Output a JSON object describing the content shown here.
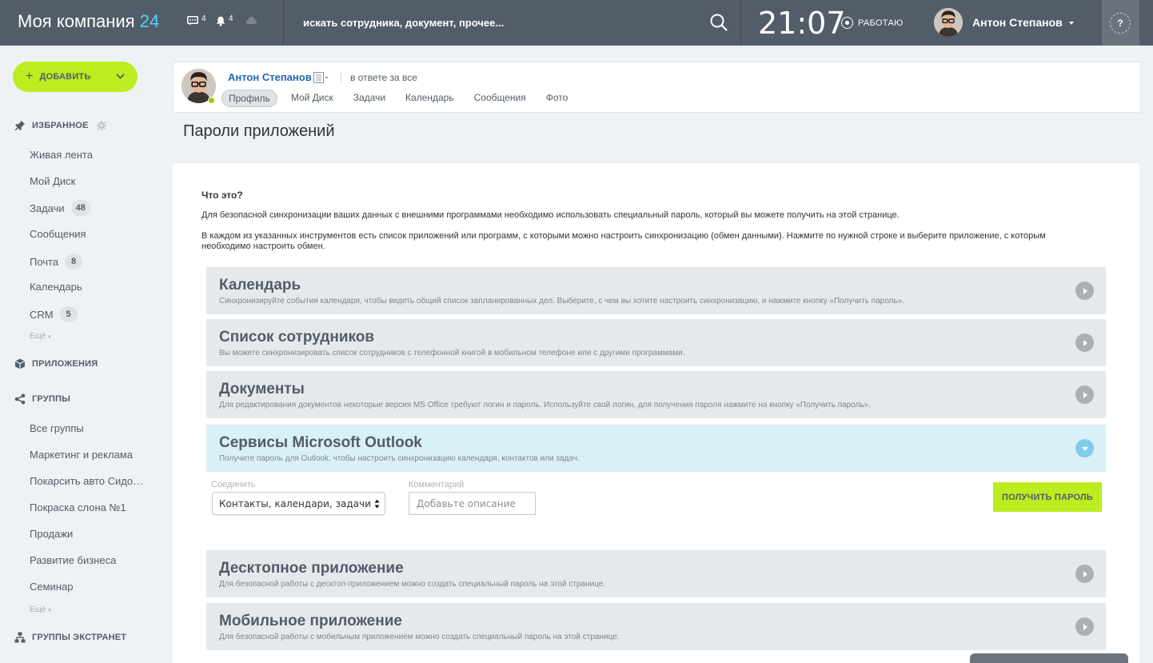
{
  "header": {
    "logo_text": "Моя компания",
    "logo_number": "24",
    "messages_count": "4",
    "notifications_count": "4",
    "search_placeholder": "искать сотрудника, документ, прочее...",
    "clock": "21:07",
    "work_status": "РАБОТАЮ",
    "user_name": "Антон Степанов",
    "help_label": "?"
  },
  "sidebar": {
    "add_label": "ДОБАВИТЬ",
    "favorites_title": "ИЗБРАННОЕ",
    "favorites": [
      {
        "label": "Живая лента",
        "badge": ""
      },
      {
        "label": "Мой Диск",
        "badge": ""
      },
      {
        "label": "Задачи",
        "badge": "48"
      },
      {
        "label": "Сообщения",
        "badge": ""
      },
      {
        "label": "Почта",
        "badge": "8"
      },
      {
        "label": "Календарь",
        "badge": ""
      },
      {
        "label": "CRM",
        "badge": "5"
      }
    ],
    "more_label": "Ещё",
    "apps_title": "ПРИЛОЖЕНИЯ",
    "groups_title": "ГРУППЫ",
    "groups": [
      "Все группы",
      "Маркетинг и реклама",
      "Покарсить авто Сидо…",
      "Покраска слона №1",
      "Продажи",
      "Развитие бизнеса",
      "Семинар"
    ],
    "extranet_title": "ГРУППЫ ЭКСТРАНЕТ"
  },
  "profile": {
    "name": "Антон Степанов",
    "status": "в ответе за все",
    "tabs": [
      "Профиль",
      "Мой Диск",
      "Задачи",
      "Календарь",
      "Сообщения",
      "Фото"
    ],
    "active_tab": "Профиль"
  },
  "page": {
    "title": "Пароли приложений",
    "what_title": "Что это?",
    "desc1": "Для безопасной синхронизации ваших данных с внешними программами необходимо использовать специальный пароль, который вы можете получить на этой странице.",
    "desc2": "В каждом из указанных инструментов есть список приложений или программ, с которыми можно настроить синхронизацию (обмен данными). Нажмите по нужной строке и выберите приложение, с которым необходимо настроить обмен."
  },
  "sections": [
    {
      "title": "Календарь",
      "subtitle": "Синхронизируйте события календаря, чтобы видеть общий список запланированных дел. Выберите, с чем вы хотите настроить синхронизацию, и нажмите кнопку «Получить пароль».",
      "open": false
    },
    {
      "title": "Список сотрудников",
      "subtitle": "Вы можете синхронизировать список сотрудников с телефонной книгой в мобильном телефоне или с другими программами.",
      "open": false
    },
    {
      "title": "Документы",
      "subtitle": "Для редактирования документов некоторые версия MS Office требуют логин и пароль. Используйте свой логин, для получения пароля нажмите на кнопку «Получить пароль».",
      "open": false
    },
    {
      "title": "Сервисы Microsoft Outlook",
      "subtitle": "Получите пароль для Outlook, чтобы настроить синхронизацию календаря, контактов или задач.",
      "open": true
    },
    {
      "title": "Десктопное приложение",
      "subtitle": "Для безопасной работы с десктоп-приложением можно создать специальный пароль на этой странице.",
      "open": false
    },
    {
      "title": "Мобильное приложение",
      "subtitle": "Для безопасной работы с мобильным приложением можно создать специальный пароль на этой странице.",
      "open": false
    }
  ],
  "outlook_form": {
    "connect_label": "Соединить",
    "connect_value": "Контакты, календари, задачи",
    "comment_label": "Комментарий",
    "comment_placeholder": "Добавьте описание",
    "get_password_label": "ПОЛУЧИТЬ ПАРОЛЬ"
  },
  "colors": {
    "header_bg": "#535c69",
    "accent_green": "#bbed21",
    "link_blue": "#2067b0",
    "logo_number": "#55d0ff",
    "open_section_bg": "#daf0f8"
  }
}
